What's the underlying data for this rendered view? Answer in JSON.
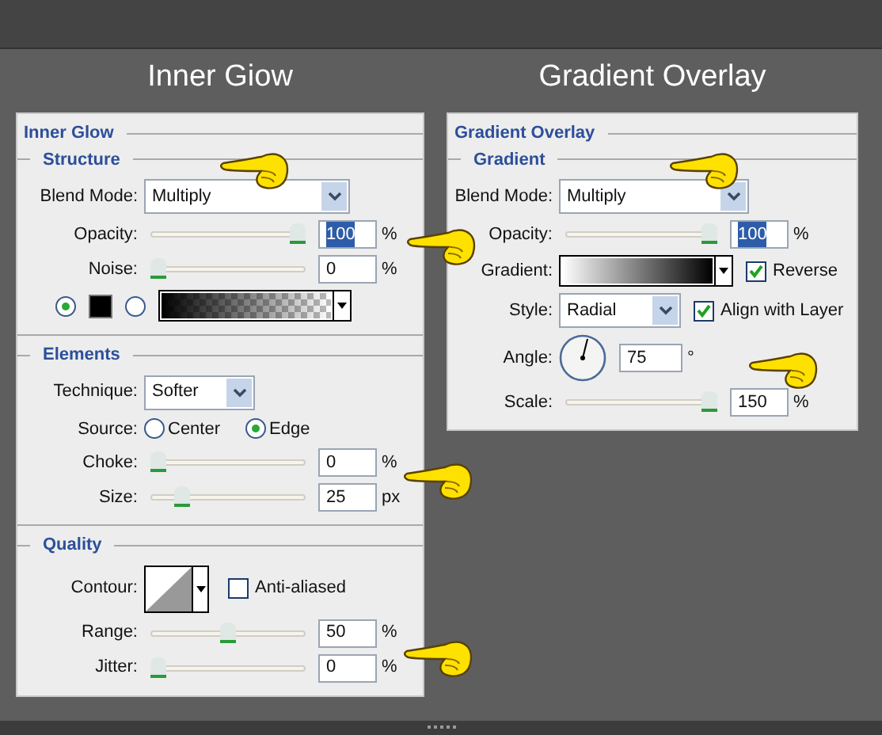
{
  "panels": [
    {
      "title": "Inner Giow",
      "dialog": "Inner Glow",
      "sections": [
        {
          "heading": "Structure",
          "rows": [
            {
              "kind": "select",
              "label": "Blend Mode:",
              "value": "Multiply"
            },
            {
              "kind": "slider",
              "label": "Opacity:",
              "level": 1,
              "value": "100",
              "unit": "%",
              "highlighted": true
            },
            {
              "kind": "slider",
              "label": "Noise:",
              "level": 0,
              "value": "0",
              "unit": "%",
              "highlighted": false
            },
            {
              "kind": "fill",
              "options": [
                {
                  "kind": "color",
                  "selected": true
                },
                {
                  "kind": "gradient",
                  "selected": false
                }
              ]
            }
          ]
        },
        {
          "heading": "Elements",
          "rows": [
            {
              "kind": "compact_select",
              "label": "Technique:",
              "value": "Softer"
            },
            {
              "kind": "radio",
              "label": "Source:",
              "options": [
                {
                  "label": "Center",
                  "selected": false
                },
                {
                  "label": "Edge",
                  "selected": true
                }
              ]
            },
            {
              "kind": "slider",
              "label": "Choke:",
              "level": 0,
              "value": "0",
              "unit": "%",
              "highlighted": false
            },
            {
              "kind": "slider",
              "label": "Size:",
              "level": 0.17,
              "value": "25",
              "unit": "px",
              "highlighted": false
            }
          ]
        },
        {
          "heading": "Quality",
          "rows": [
            {
              "kind": "contour",
              "label": "Contour:",
              "checkbox": {
                "label": "Anti-aliased",
                "checked": false
              }
            },
            {
              "kind": "slider",
              "label": "Range:",
              "level": 0.5,
              "value": "50",
              "unit": "%",
              "highlighted": false
            },
            {
              "kind": "slider",
              "label": "Jitter:",
              "level": 0,
              "value": "0",
              "unit": "%",
              "highlighted": false
            }
          ]
        }
      ]
    },
    {
      "title": "Gradient Overlay",
      "dialog": "Gradient Overlay",
      "sections": [
        {
          "heading": "Gradient",
          "rows": [
            {
              "kind": "select",
              "label": "Blend Mode:",
              "value": "Multiply"
            },
            {
              "kind": "slider",
              "label": "Opacity:",
              "level": 1,
              "value": "100",
              "unit": "%",
              "highlighted": true
            },
            {
              "kind": "gradient",
              "label": "Gradient:",
              "checkbox": {
                "label": "Reverse",
                "checked": true
              }
            },
            {
              "kind": "style",
              "label": "Style:",
              "value": "Radial",
              "checkbox": {
                "label": "Align with Layer",
                "checked": true
              }
            },
            {
              "kind": "angle",
              "label": "Angle:",
              "value": "75",
              "unit": "°"
            },
            {
              "kind": "slider",
              "label": "Scale:",
              "level": 1,
              "value": "150",
              "unit": "%",
              "highlighted": false
            }
          ]
        }
      ]
    }
  ]
}
